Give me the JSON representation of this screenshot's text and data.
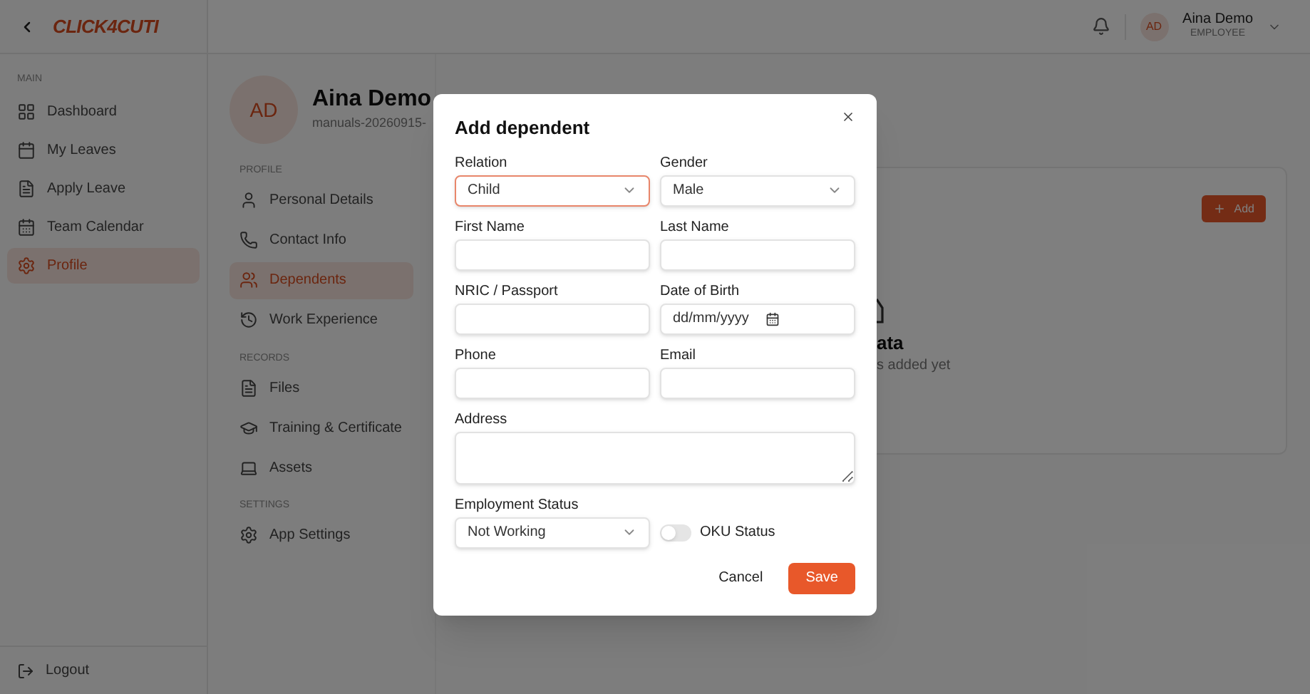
{
  "logo": "CLICK4CUTI",
  "header": {
    "user_initials": "AD",
    "user_name": "Aina Demo",
    "user_role": "EMPLOYEE"
  },
  "sidebar": {
    "section": "MAIN",
    "items": [
      {
        "label": "Dashboard",
        "selected": false
      },
      {
        "label": "My Leaves",
        "selected": false
      },
      {
        "label": "Apply Leave",
        "selected": false
      },
      {
        "label": "Team Calendar",
        "selected": false
      },
      {
        "label": "Profile",
        "selected": true
      }
    ],
    "logout": "Logout"
  },
  "profile": {
    "initials": "AD",
    "name": "Aina Demo",
    "subtitle": "manuals-20260915-",
    "sections": [
      {
        "title": "PROFILE",
        "items": [
          {
            "label": "Personal Details",
            "selected": false
          },
          {
            "label": "Contact Info",
            "selected": false
          },
          {
            "label": "Dependents",
            "selected": true
          },
          {
            "label": "Work Experience",
            "selected": false
          }
        ]
      },
      {
        "title": "RECORDS",
        "items": [
          {
            "label": "Files",
            "selected": false
          },
          {
            "label": "Training & Certificate",
            "selected": false
          },
          {
            "label": "Assets",
            "selected": false
          }
        ]
      },
      {
        "title": "SETTINGS",
        "items": [
          {
            "label": "App Settings",
            "selected": false
          }
        ]
      }
    ]
  },
  "card": {
    "add_button": "Add",
    "empty_title": "ata",
    "empty_text": "s added yet"
  },
  "modal": {
    "title": "Add dependent",
    "fields": [
      {
        "label": "Relation",
        "kind": "select",
        "value": "Child",
        "focused": true
      },
      {
        "label": "Gender",
        "kind": "select",
        "value": "Male",
        "focused": false
      },
      {
        "label": "First Name",
        "kind": "text",
        "focused": false
      },
      {
        "label": "Last Name",
        "kind": "text",
        "focused": false
      },
      {
        "label": "NRIC / Passport",
        "kind": "text",
        "focused": false
      },
      {
        "label": "Date of Birth",
        "kind": "date",
        "placeholder": "dd/mm/yyyy",
        "focused": false
      },
      {
        "label": "Phone",
        "kind": "text",
        "focused": false
      },
      {
        "label": "Email",
        "kind": "text",
        "focused": false
      },
      {
        "label": "Address",
        "kind": "textarea",
        "focused": false
      },
      {
        "label": "Employment Status",
        "kind": "select",
        "value": "Not Working",
        "focused": false
      },
      {
        "label": "OKU Status",
        "kind": "toggle",
        "on": false
      }
    ],
    "cancel": "Cancel",
    "save": "Save"
  }
}
